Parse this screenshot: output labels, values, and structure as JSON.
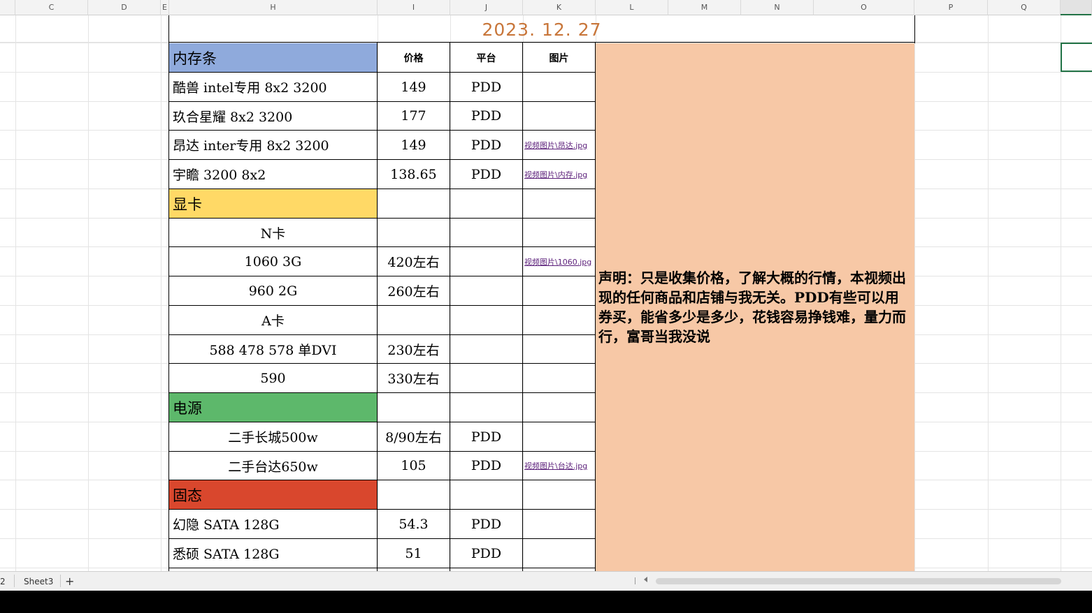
{
  "columns": [
    "C",
    "D",
    "E",
    "H",
    "I",
    "J",
    "K",
    "L",
    "M",
    "N",
    "O",
    "P",
    "Q"
  ],
  "sheet": {
    "date": "2023. 12. 27",
    "headers": {
      "price": "价格",
      "platform": "平台",
      "image": "图片"
    },
    "rows": [
      {
        "type": "category",
        "name": "内存条",
        "color": "#8faadc"
      },
      {
        "type": "item",
        "name": "酷兽 intel专用 8x2 3200",
        "price": "149",
        "platform": "PDD",
        "image": ""
      },
      {
        "type": "item",
        "name": "玖合星耀  8x2  3200",
        "price": "177",
        "platform": "PDD",
        "image": ""
      },
      {
        "type": "item",
        "name": "昂达 inter专用 8x2 3200",
        "price": "149",
        "platform": "PDD",
        "image": "视频图片\\昂达.jpg"
      },
      {
        "type": "item",
        "name": "宇瞻 3200 8x2",
        "price": "138.65",
        "platform": "PDD",
        "image": "视频图片\\内存.jpg"
      },
      {
        "type": "category",
        "name": "显卡",
        "color": "#ffd966"
      },
      {
        "type": "sub",
        "name": "N卡",
        "price": "",
        "platform": "",
        "image": ""
      },
      {
        "type": "sub",
        "name": "1060 3G",
        "price": "420左右",
        "platform": "",
        "image": "视频图片\\1060.jpg"
      },
      {
        "type": "sub",
        "name": "960  2G",
        "price": "260左右",
        "platform": "",
        "image": ""
      },
      {
        "type": "sub",
        "name": "A卡",
        "price": "",
        "platform": "",
        "image": ""
      },
      {
        "type": "sub",
        "name": "588  478  578 单DVI",
        "price": "230左右",
        "platform": "",
        "image": ""
      },
      {
        "type": "sub",
        "name": "590",
        "price": "330左右",
        "platform": "",
        "image": ""
      },
      {
        "type": "category",
        "name": "电源",
        "color": "#5db86b"
      },
      {
        "type": "sub",
        "name": "二手长城500w",
        "price": "8/90左右",
        "platform": "PDD",
        "image": ""
      },
      {
        "type": "sub",
        "name": "二手台达650w",
        "price": "105",
        "platform": "PDD",
        "image": "视频图片\\台达.jpg"
      },
      {
        "type": "category",
        "name": "固态",
        "color": "#d9472d"
      },
      {
        "type": "item",
        "name": "幻隐 SATA  128G",
        "price": "54.3",
        "platform": "PDD",
        "image": ""
      },
      {
        "type": "item",
        "name": "悉硕 SATA  128G",
        "price": "51",
        "platform": "PDD",
        "image": ""
      }
    ],
    "notice": "声明：只是收集价格，了解大概的行情，本视频出现的任何商品和店铺与我无关。PDD有些可以用券买，能省多少是多少，花钱容易挣钱难，量力而行，富哥当我没说"
  },
  "tabs": {
    "prev_tab": "2",
    "active_tab": "Sheet3",
    "add": "+"
  },
  "colors": {
    "title": "#c8763a",
    "notice_bg": "#f7c8a6",
    "link": "#5b1f7a",
    "selection": "#217346"
  }
}
